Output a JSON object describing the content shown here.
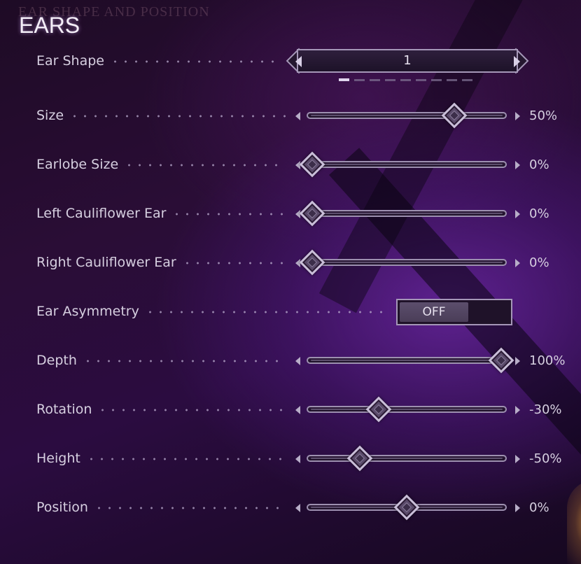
{
  "header": {
    "ghost_title": "EAR SHAPE AND POSITION",
    "title": "EARS"
  },
  "ear_shape": {
    "label": "Ear Shape",
    "value": "1",
    "page_count": 9,
    "active_page": 0
  },
  "sliders": [
    {
      "key": "size",
      "label": "Size",
      "value_text": "50%",
      "fraction": 0.75
    },
    {
      "key": "earlobe-size",
      "label": "Earlobe Size",
      "value_text": "0%",
      "fraction": 0.0
    },
    {
      "key": "left-cauliflower-ear",
      "label": "Left Cauliflower Ear",
      "value_text": "0%",
      "fraction": 0.0
    },
    {
      "key": "right-cauliflower-ear",
      "label": "Right Cauliflower Ear",
      "value_text": "0%",
      "fraction": 0.0
    }
  ],
  "ear_asymmetry": {
    "label": "Ear Asymmetry",
    "state": "OFF"
  },
  "sliders_2": [
    {
      "key": "depth",
      "label": "Depth",
      "value_text": "100%",
      "fraction": 1.0
    },
    {
      "key": "rotation",
      "label": "Rotation",
      "value_text": "-30%",
      "fraction": 0.35
    },
    {
      "key": "height",
      "label": "Height",
      "value_text": "-50%",
      "fraction": 0.25
    },
    {
      "key": "position",
      "label": "Position",
      "value_text": "0%",
      "fraction": 0.5
    }
  ],
  "colors": {
    "accent": "#c9bed8",
    "text": "#d6cfe0",
    "background_glow": "#6e28aa"
  }
}
